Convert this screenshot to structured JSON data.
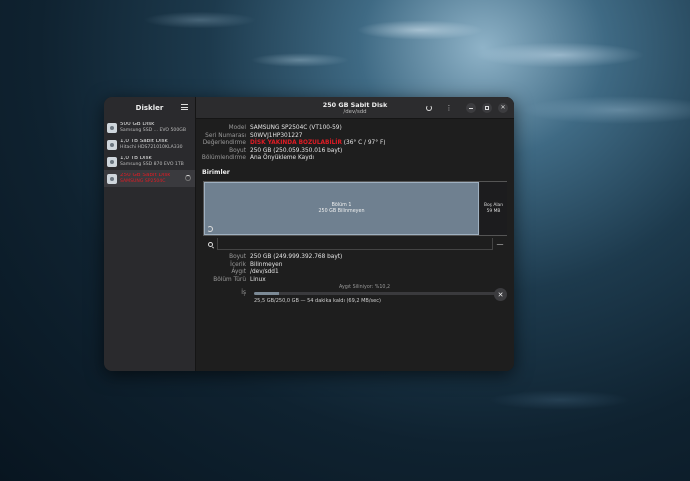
{
  "sidebar": {
    "title": "Diskler",
    "disks": [
      {
        "name": "500 GB Disk",
        "model": "Samsung SSD ... EVO 500GB"
      },
      {
        "name": "1,0 TB Sabit Disk",
        "model": "Hitachi HDS721010KLA330"
      },
      {
        "name": "1,0 TB Disk",
        "model": "Samsung SSD 870 EVO 1TB"
      },
      {
        "name": "250 GB Sabit Disk",
        "model": "SAMSUNG SP2504C"
      }
    ]
  },
  "header": {
    "title": "250 GB Sabit Disk",
    "subtitle": "/dev/sdd"
  },
  "drive": {
    "model_label": "Model",
    "model": "SAMSUNG SP2504C (VT100-59)",
    "serial_label": "Seri Numarası",
    "serial": "S0WVJ1HP301227",
    "assessment_label": "Değerlendirme",
    "assessment_warning": "DİSK YAKINDA BOZULABİLİR",
    "assessment_temp": "(36° C / 97° F)",
    "size_label": "Boyut",
    "size": "250 GB (250.059.350.016 bayt)",
    "partitioning_label": "Bölümlendirme",
    "partitioning": "Ana Önyükleme Kaydı"
  },
  "volumes": {
    "section_title": "Birimler",
    "partition_name": "Bölüm 1",
    "partition_desc": "250 GB Bilinmeyen",
    "free_name": "Boş Alan",
    "free_size": "59 MB"
  },
  "volume_props": {
    "size_label": "Boyut",
    "size": "250 GB (249.999.392.768 bayt)",
    "contents_label": "İçerik",
    "contents": "Bilinmeyen",
    "device_label": "Aygıt",
    "device": "/dev/sdd1",
    "type_label": "Bölüm Türü",
    "type": "Linux"
  },
  "job": {
    "label": "İş",
    "caption": "Aygıt Siliniyor: %10,2",
    "progress_fraction": 0.102,
    "detail": "25,5 GB/250,0 GB — 54 dakika kaldı (69,2 MB/sec)"
  },
  "colors": {
    "warning": "#e01b24",
    "partition": "#6f8090"
  }
}
